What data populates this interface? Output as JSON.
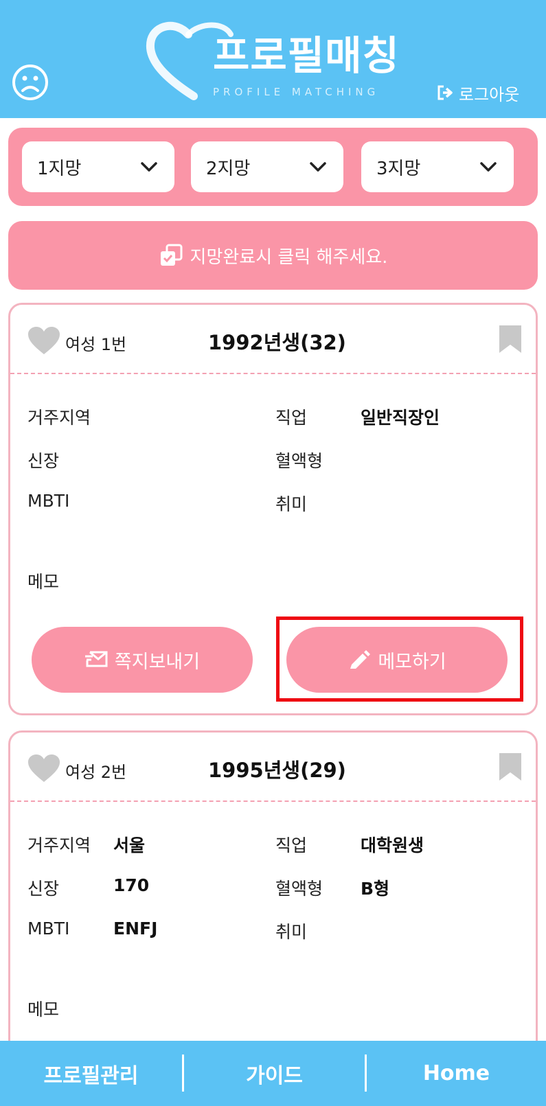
{
  "header": {
    "title": "프로필매칭",
    "subtitle": "PROFILE MATCHING",
    "logout_label": "로그아웃",
    "sad_icon": "sad-face-icon"
  },
  "choices": [
    {
      "label": "1지망"
    },
    {
      "label": "2지망"
    },
    {
      "label": "3지망"
    }
  ],
  "confirm": {
    "label": "지망완료시 클릭 해주세요."
  },
  "cards": [
    {
      "gender_no": "여성 1번",
      "birth": "1992년생(32)",
      "fields": {
        "region_label": "거주지역",
        "region_value": "",
        "job_label": "직업",
        "job_value": "일반직장인",
        "height_label": "신장",
        "height_value": "",
        "blood_label": "혈액형",
        "blood_value": "",
        "mbti_label": "MBTI",
        "mbti_value": "",
        "hobby_label": "취미",
        "hobby_value": "",
        "memo_label": "메모"
      },
      "send_label": "쪽지보내기",
      "memo_button_label": "메모하기"
    },
    {
      "gender_no": "여성 2번",
      "birth": "1995년생(29)",
      "fields": {
        "region_label": "거주지역",
        "region_value": "서울",
        "job_label": "직업",
        "job_value": "대학원생",
        "height_label": "신장",
        "height_value": "170",
        "blood_label": "혈액형",
        "blood_value": "B형",
        "mbti_label": "MBTI",
        "mbti_value": "ENFJ",
        "hobby_label": "취미",
        "hobby_value": "",
        "memo_label": "메모"
      }
    }
  ],
  "bottom_nav": [
    {
      "label": "프로필관리"
    },
    {
      "label": "가이드"
    },
    {
      "label": "Home"
    }
  ],
  "colors": {
    "header_blue": "#5bc2f4",
    "accent_pink": "#fa95a7",
    "card_border": "#f3b4c0",
    "highlight_red": "#ee0a12",
    "icon_gray": "#c8c8c8"
  }
}
